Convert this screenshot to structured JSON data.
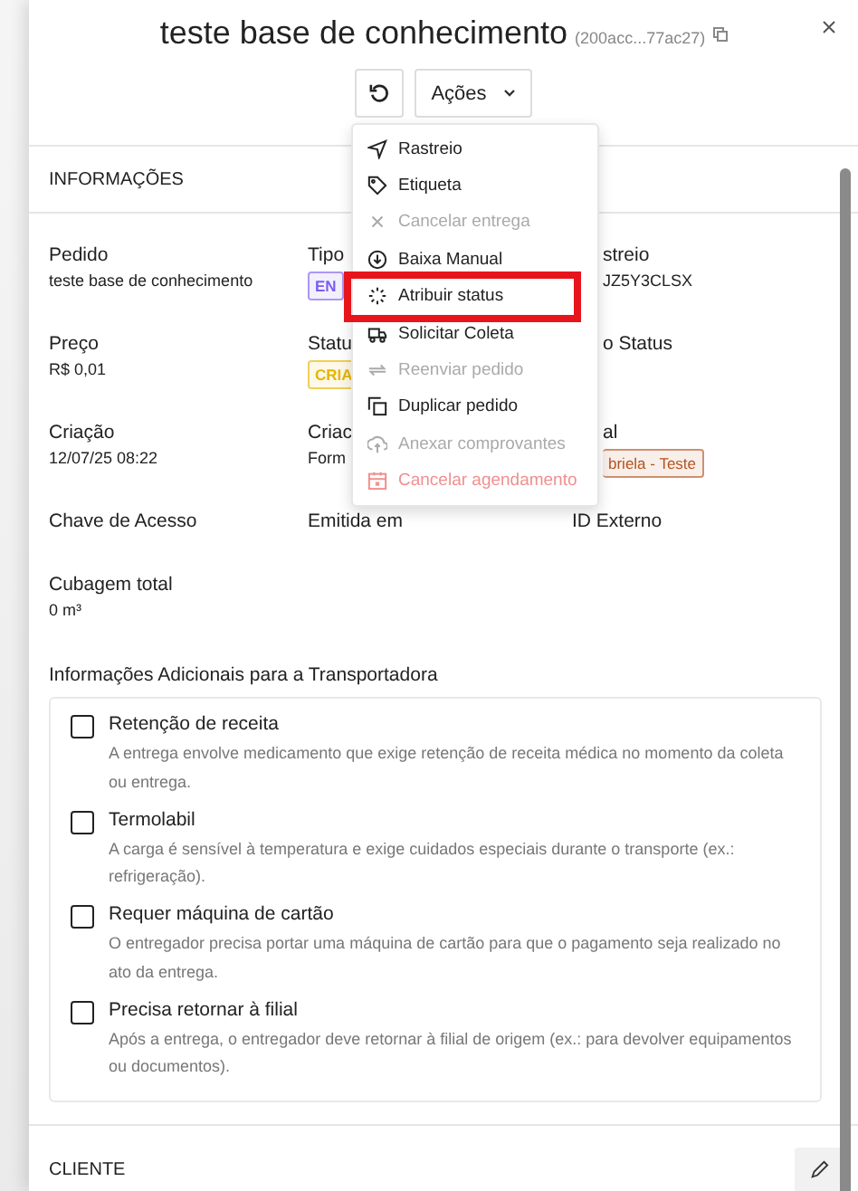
{
  "header": {
    "title": "teste base de conhecimento",
    "id": "(200acc...77ac27)",
    "actions_label": "Ações"
  },
  "actions_menu": [
    {
      "label": "Rastreio",
      "kind": "navigate",
      "disabled": false,
      "highlighted": false
    },
    {
      "label": "Etiqueta",
      "kind": "tag",
      "disabled": false,
      "highlighted": false
    },
    {
      "label": "Cancelar entrega",
      "kind": "cancel",
      "disabled": true,
      "highlighted": false
    },
    {
      "label": "Baixa Manual",
      "kind": "download",
      "disabled": false,
      "highlighted": false
    },
    {
      "label": "Atribuir status",
      "kind": "loader",
      "disabled": false,
      "highlighted": true
    },
    {
      "label": "Solicitar Coleta",
      "kind": "truck",
      "disabled": false,
      "highlighted": false
    },
    {
      "label": "Reenviar pedido",
      "kind": "repeat",
      "disabled": true,
      "highlighted": false
    },
    {
      "label": "Duplicar pedido",
      "kind": "copy",
      "disabled": false,
      "highlighted": false
    },
    {
      "label": "Anexar comprovantes",
      "kind": "upload",
      "disabled": true,
      "highlighted": false
    },
    {
      "label": "Cancelar agendamento",
      "kind": "calendar",
      "disabled": true,
      "highlighted": false
    }
  ],
  "info": {
    "title": "INFORMAÇÕES",
    "fields": [
      {
        "label": "Pedido",
        "value": "teste base de conhecimento",
        "kind": "text"
      },
      {
        "label": "Tipo",
        "value": "EN",
        "kind": "badge",
        "color": "#7c5cf0"
      },
      {
        "label": "streio",
        "value": "JZ5Y3CLSX",
        "kind": "partial"
      },
      {
        "label": "Preço",
        "value": "R$ 0,01",
        "kind": "text"
      },
      {
        "label": "Statu",
        "value": "CRIA",
        "kind": "badge",
        "color": "#e8b400"
      },
      {
        "label": "o Status",
        "kind": "partial"
      },
      {
        "label": "Criação",
        "value": "12/07/25 08:22",
        "kind": "text"
      },
      {
        "label": "Criac",
        "value": "Form",
        "kind": "text"
      },
      {
        "label": "al",
        "value": "briela - Teste",
        "kind": "partial-badge",
        "color": "#b5531d"
      },
      {
        "label": "Chave de Acesso",
        "kind": "text"
      },
      {
        "label": "Emitida em",
        "kind": "text"
      },
      {
        "label": "ID Externo",
        "kind": "text"
      },
      {
        "label": "Cubagem total",
        "value": "0 m³",
        "kind": "text"
      }
    ],
    "additional_title": "Informações Adicionais para a Transportadora",
    "options": [
      {
        "label": "Retenção de receita",
        "description": "A entrega envolve medicamento que exige retenção de receita médica no momento da coleta ou entrega.",
        "checked": false
      },
      {
        "label": "Termolabil",
        "description": "A carga é sensível à temperatura e exige cuidados especiais durante o transporte (ex.: refrigeração).",
        "checked": false
      },
      {
        "label": "Requer máquina de cartão",
        "description": "O entregador precisa portar uma máquina de cartão para que o pagamento seja realizado no ato da entrega.",
        "checked": false
      },
      {
        "label": "Precisa retornar à filial",
        "description": "Após a entrega, o entregador deve retornar à filial de origem (ex.: para devolver equipamentos ou documentos).",
        "checked": false
      }
    ]
  },
  "client": {
    "title": "CLIENTE"
  }
}
